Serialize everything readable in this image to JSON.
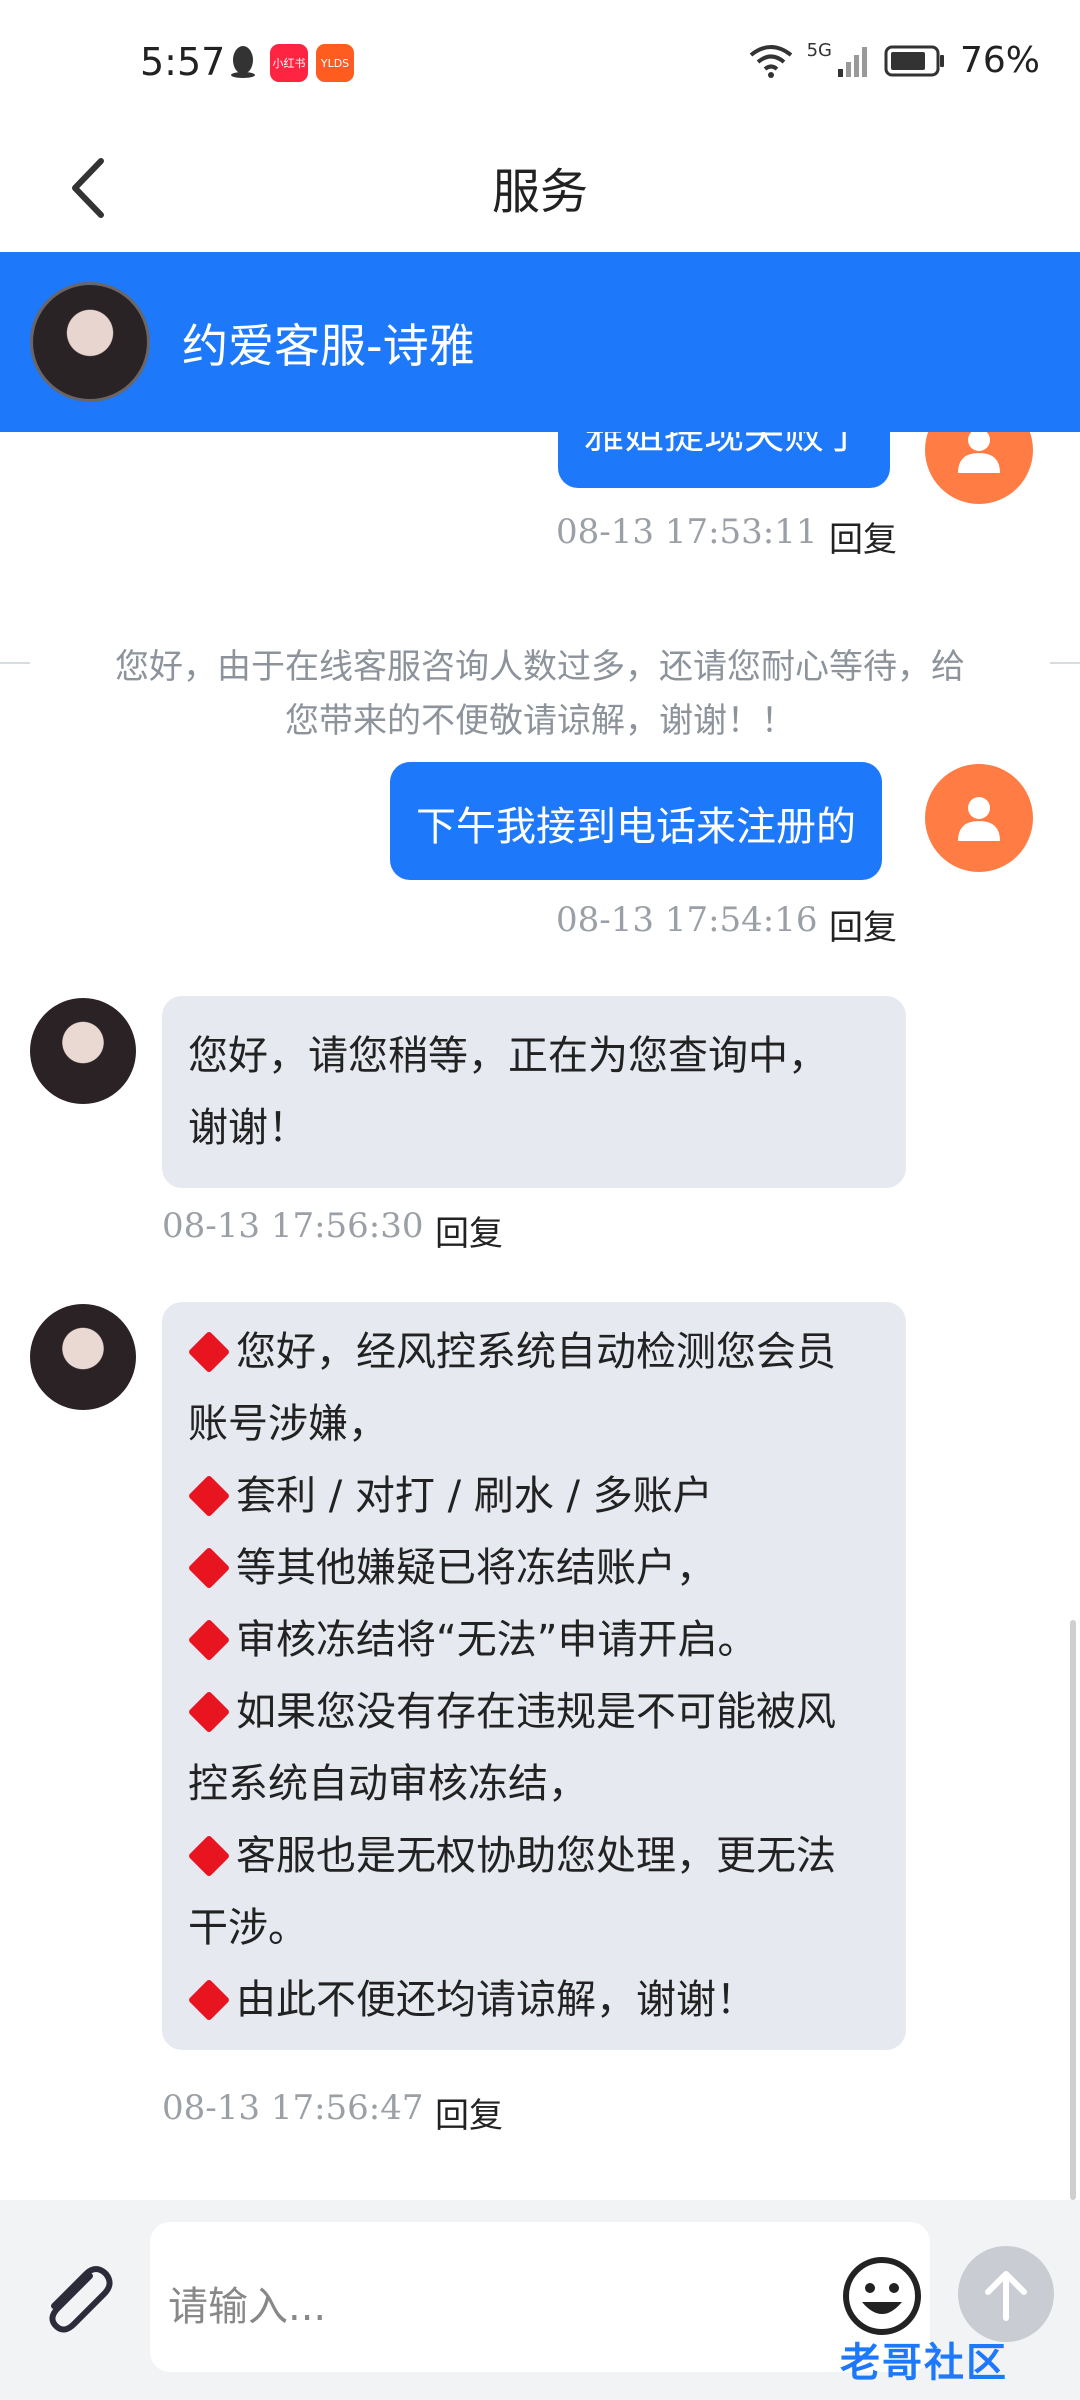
{
  "status_bar": {
    "time": "5:57",
    "app1_label": "小红书",
    "app2_label": "YLDS",
    "network": "5G",
    "battery": "76%"
  },
  "header": {
    "title": "服务"
  },
  "agent": {
    "name": "约爱客服-诗雅"
  },
  "messages": {
    "partial_user_text": "雅姐提现失败了",
    "m1_time": "08-13 17:53:11",
    "system_notice_line1": "您好，由于在线客服咨询人数过多，还请您耐心等待，给",
    "system_notice_line2": "您带来的不便敬请谅解，谢谢！！",
    "m2_text": "下午我接到电话来注册的",
    "m2_time": "08-13 17:54:16",
    "m3_line1": "您好，请您稍等，正在为您查询中，",
    "m3_line2": "谢谢！",
    "m3_time": "08-13 17:56:30",
    "m4_lines": [
      "您好，经风控系统自动检测您会员",
      "账号涉嫌，",
      "套利 / 对打 / 刷水 / 多账户",
      "等其他嫌疑已将冻结账户，",
      "审核冻结将“无法”申请开启。",
      "如果您没有存在违规是不可能被风",
      "控系统自动审核冻结，",
      "客服也是无权协助您处理，更无法",
      "干涉。",
      "由此不便还均请谅解，谢谢！"
    ],
    "m4_time": "08-13 17:56:47",
    "reply_label": "回复"
  },
  "input": {
    "placeholder": "请输入..."
  },
  "watermark": "老哥社区",
  "colors": {
    "primary": "#1e78fa",
    "user_avatar": "#ff7c45",
    "agent_bubble": "#e6e9f0",
    "alert_diamond": "#e8141f"
  }
}
